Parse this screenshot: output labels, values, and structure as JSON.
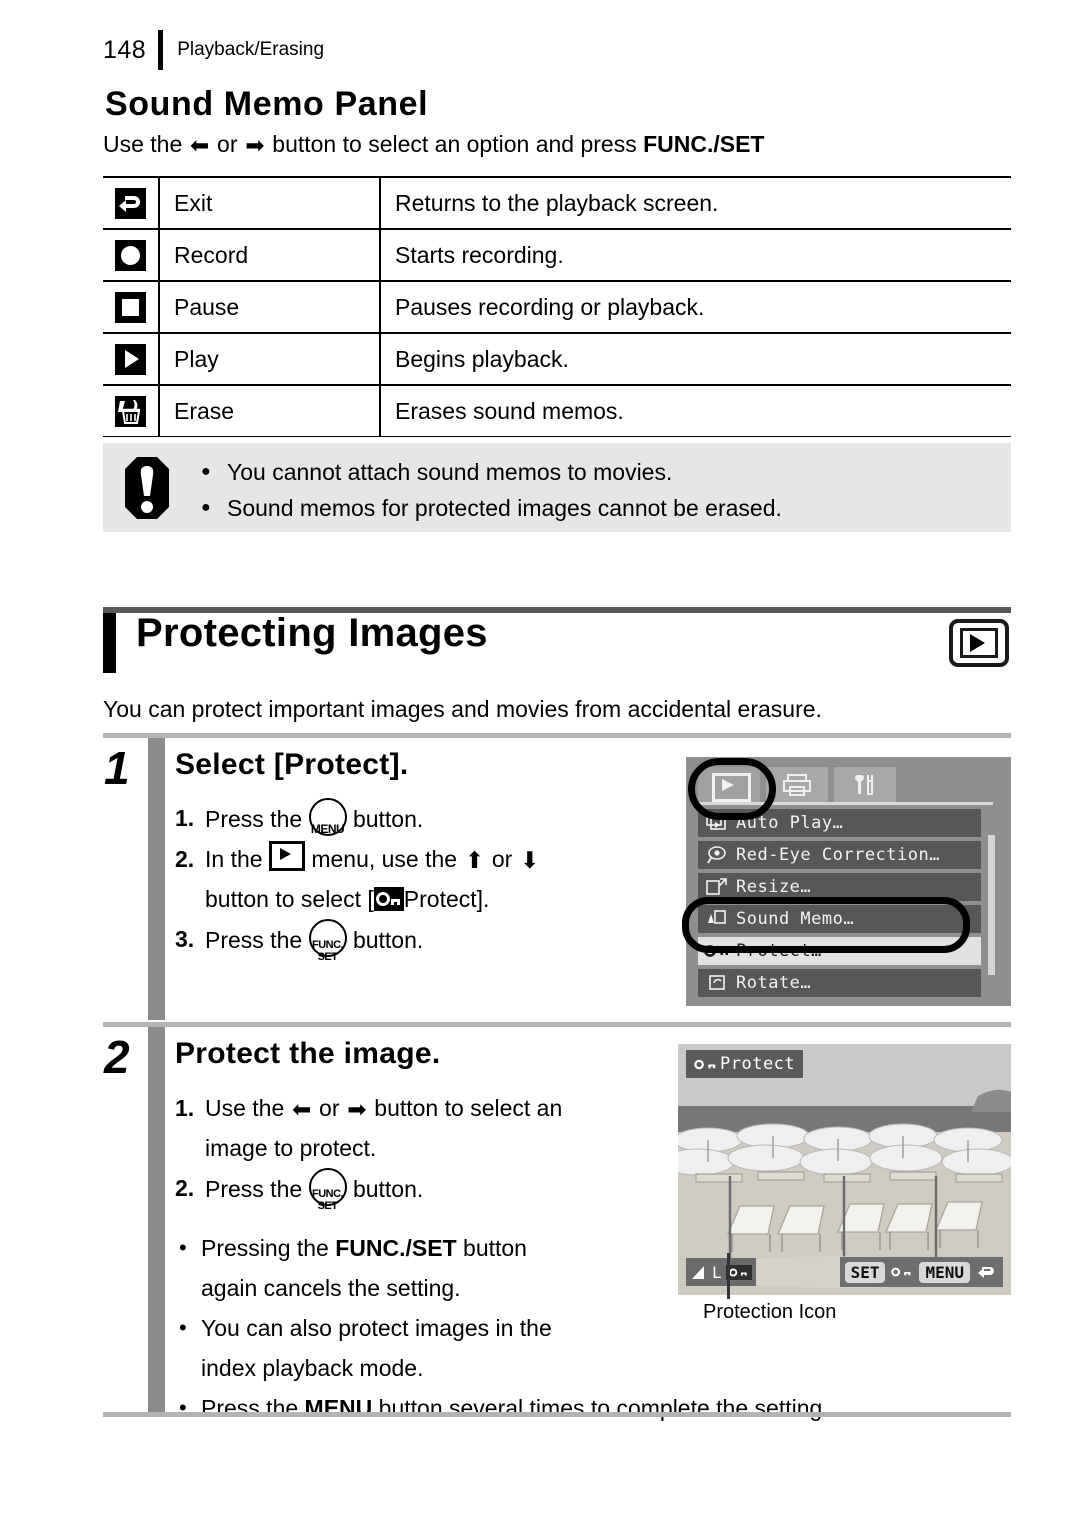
{
  "header": {
    "page_number": "148",
    "section": "Playback/Erasing"
  },
  "sound_memo": {
    "title": "Sound Memo Panel",
    "lead_part1": "Use the",
    "lead_or": "or",
    "lead_part2": "button to select an option and press",
    "lead_bold": "FUNC./SET",
    "table": {
      "rows": [
        {
          "icon": "return-exit-icon",
          "name": "Exit",
          "desc": "Returns to the playback screen."
        },
        {
          "icon": "record-circle-icon",
          "name": "Record",
          "desc": "Starts recording."
        },
        {
          "icon": "pause-square-icon",
          "name": "Pause",
          "desc": "Pauses recording or playback."
        },
        {
          "icon": "play-triangle-icon",
          "name": "Play",
          "desc": "Begins playback."
        },
        {
          "icon": "trash-erase-icon",
          "name": "Erase",
          "desc": "Erases sound memos."
        }
      ]
    },
    "caution": {
      "icon": "exclamation-icon",
      "items": [
        "You cannot attach sound memos to movies.",
        "Sound memos for protected images cannot be erased."
      ]
    }
  },
  "protecting": {
    "title": "Protecting Images",
    "badge_icon": "playback-mode-icon",
    "lead": "You can protect important images and movies from accidental erasure.",
    "step1": {
      "number": "1",
      "heading": "Select [Protect].",
      "items": [
        {
          "num": "1.",
          "pre": "Press the",
          "btn": "MENU",
          "post": "button."
        },
        {
          "num": "2.",
          "pre": "In the",
          "icon": "playback-menu-icon",
          "mid": "menu, use the",
          "or": "or",
          "post": "",
          "cont_pre": "button to select [",
          "cont_icon": "key-protect-icon",
          "cont_post": "Protect]."
        },
        {
          "num": "3.",
          "pre": "Press the",
          "btn": "FUNC./SET",
          "post": "button."
        }
      ],
      "lcd": {
        "tabs": [
          {
            "name": "playback-tab",
            "icon": "play-icon",
            "selected": true
          },
          {
            "name": "print-tab",
            "icon": "printer-icon",
            "selected": false
          },
          {
            "name": "settings-tab",
            "icon": "tools-icon",
            "selected": false
          }
        ],
        "menu_items": [
          {
            "label": "Auto Play…",
            "icon": "auto-play-icon",
            "selected": false
          },
          {
            "label": "Red-Eye Correction…",
            "icon": "red-eye-icon",
            "selected": false
          },
          {
            "label": "Resize…",
            "icon": "resize-icon",
            "selected": false
          },
          {
            "label": "Sound Memo…",
            "icon": "sound-memo-icon",
            "selected": false
          },
          {
            "label": "Protect…",
            "icon": "key-icon",
            "selected": true
          },
          {
            "label": "Rotate…",
            "icon": "rotate-icon",
            "selected": false
          }
        ]
      }
    },
    "step2": {
      "number": "2",
      "heading": "Protect the image.",
      "items": [
        {
          "num": "1.",
          "pre": "Use the",
          "or": "or",
          "post": "button to select an",
          "cont": "image to protect."
        },
        {
          "num": "2.",
          "pre": "Press the",
          "btn": "FUNC./SET",
          "post": "button."
        }
      ],
      "bullets": [
        {
          "pre": "Pressing the ",
          "bold": "FUNC./SET",
          "post": " button",
          "cont": "again cancels the setting."
        },
        {
          "pre": "You can also protect images in the",
          "bold": "",
          "post": "",
          "cont": "index playback mode."
        },
        {
          "pre": "Press the ",
          "bold": "MENU",
          "post": " button several times to complete the setting.",
          "cont": ""
        }
      ],
      "lcd": {
        "protect_label": "Protect",
        "protect_icon": "key-icon",
        "quality_label": "L",
        "quality_protect_icon": "key-icon",
        "buttons": [
          {
            "label": "SET",
            "name": "set-chip"
          },
          {
            "label": "",
            "name": "key-icon"
          },
          {
            "label": "MENU",
            "name": "menu-chip"
          },
          {
            "label": "",
            "name": "return-icon"
          }
        ]
      },
      "caption": "Protection Icon"
    }
  },
  "colors": {
    "rule_gray": "#b3b3b3",
    "step_bar_gray": "#8c8c8c",
    "note_bg": "#e6e6e6",
    "chap_rule": "#595959",
    "lcd_bg": "#8f8f8f",
    "lcd_item": "#575757",
    "lcd_item_selected": "#e2e2e2"
  }
}
